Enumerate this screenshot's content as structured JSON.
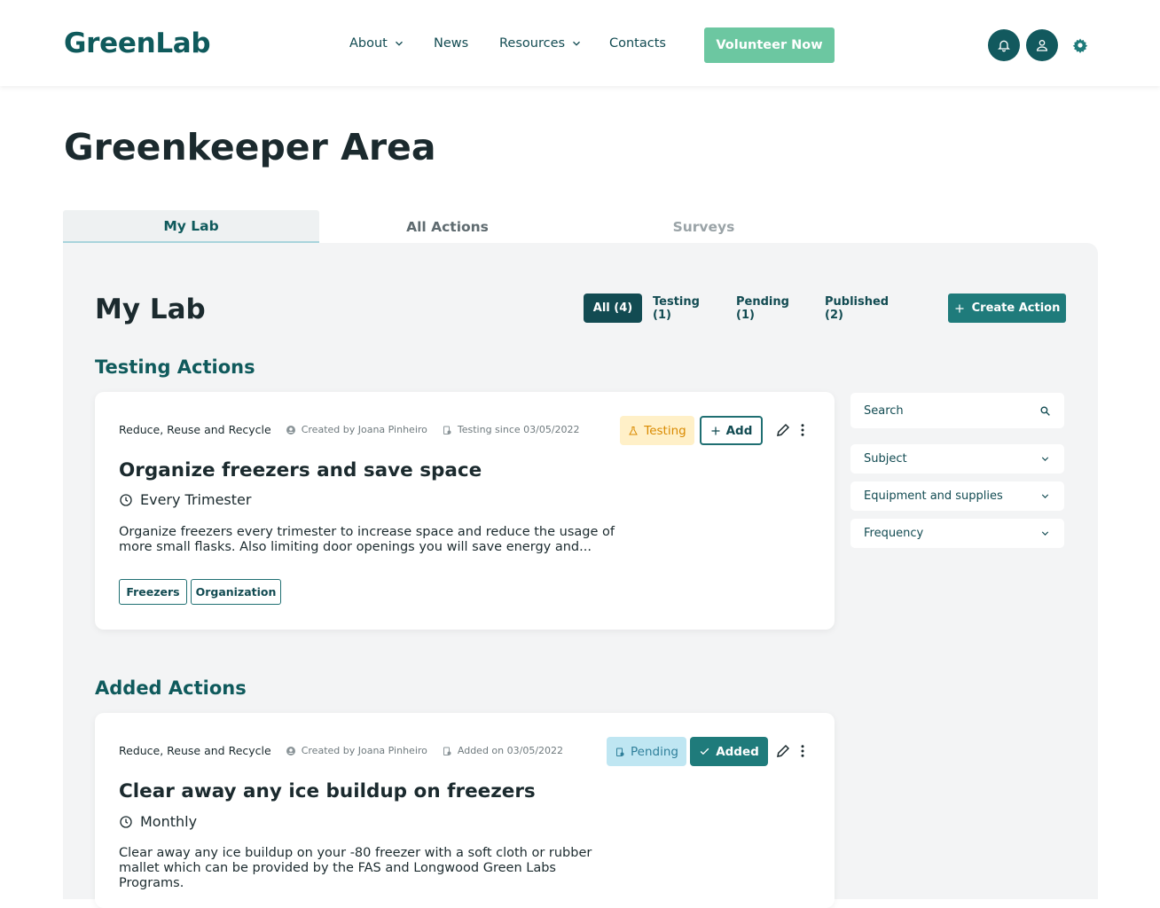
{
  "header": {
    "logo": "GreenLab",
    "nav": [
      {
        "label": "About",
        "has_dropdown": true
      },
      {
        "label": "News",
        "has_dropdown": false
      },
      {
        "label": "Resources",
        "has_dropdown": true
      },
      {
        "label": "Contacts",
        "has_dropdown": false
      }
    ],
    "cta_label": "Volunteer Now",
    "icons": [
      "bell-icon",
      "user-icon",
      "gear-icon"
    ]
  },
  "page_title": "Greenkeeper Area",
  "tabs": [
    {
      "label": "My Lab",
      "active": true
    },
    {
      "label": "All Actions",
      "active": false
    },
    {
      "label": "Surveys",
      "active": false
    }
  ],
  "main": {
    "heading": "My Lab",
    "filters": [
      {
        "label": "All (4)",
        "active": true
      },
      {
        "label": "Testing (1)",
        "active": false
      },
      {
        "label": "Pending (1)",
        "active": false
      },
      {
        "label": "Published (2)",
        "active": false
      }
    ],
    "create_label": "Create Action",
    "testing_section_title": "Testing Actions",
    "added_section_title": "Added Actions"
  },
  "cards": [
    {
      "category": "Reduce, Reuse and Recycle",
      "created_by": "Created by Joana Pinheiro",
      "status_date": "Testing since 03/05/2022",
      "title": "Organize freezers and save space",
      "frequency": "Every Trimester",
      "description": "Organize freezers every trimester to increase space and reduce the usage of more small flasks. Also limiting door openings you will save energy and...",
      "tags": [
        "Freezers",
        "Organization"
      ],
      "status_label": "Testing",
      "action_label": "Add"
    },
    {
      "category": "Reduce, Reuse and Recycle",
      "created_by": "Created by Joana Pinheiro",
      "status_date": "Added on 03/05/2022",
      "title": "Clear away any ice buildup on freezers",
      "frequency": "Monthly",
      "description": "Clear away any ice buildup on your -80 freezer with a soft cloth or rubber mallet which can be provided by the FAS and Longwood Green Labs Programs.",
      "status_label": "Pending",
      "action_label": "Added"
    }
  ],
  "sidebar": {
    "search_placeholder": "Search",
    "dropdowns": [
      "Subject",
      "Equipment and supplies",
      "Frequency"
    ]
  },
  "colors": {
    "brand_dark": "#124b52",
    "brand_teal": "#1f7b7b",
    "brand_green": "#6cc7a1",
    "testing_bg": "#fff0c8",
    "pending_bg": "#bfe6f2"
  }
}
